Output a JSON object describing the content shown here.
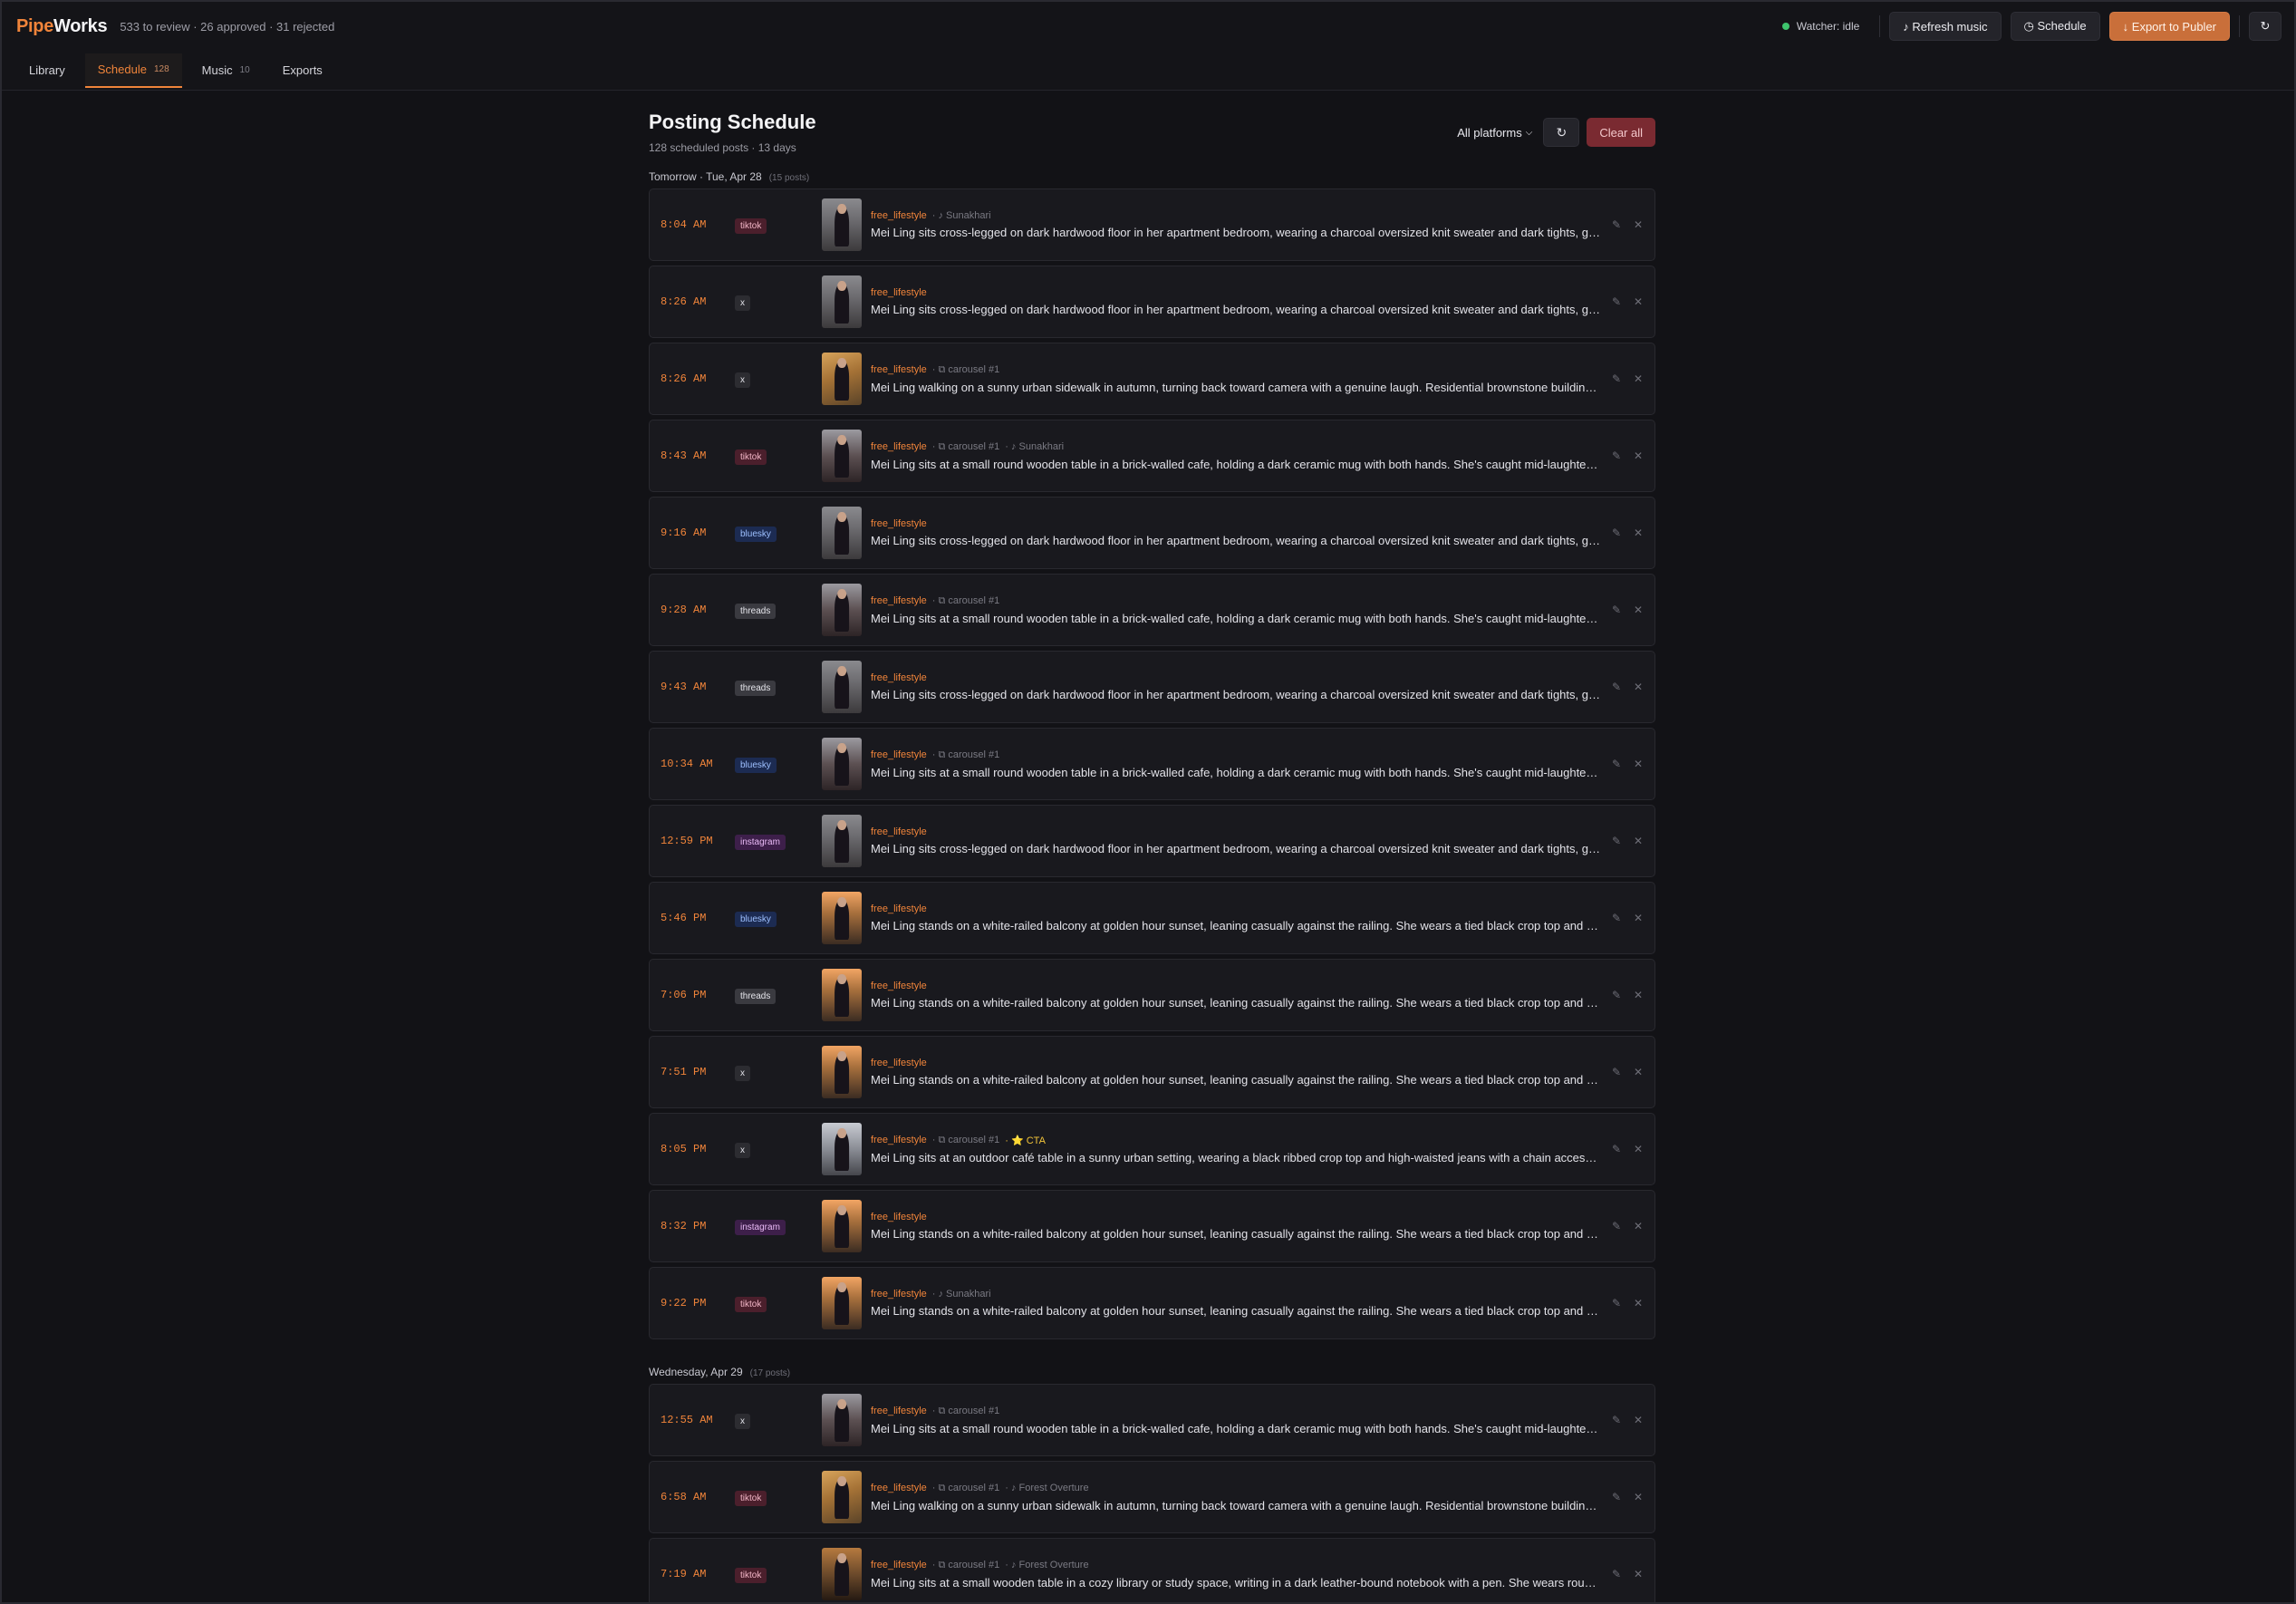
{
  "app": {
    "logo_part1": "Pipe",
    "logo_part2": "Works",
    "stats": "533 to review · 26 approved · 31 rejected",
    "watcher": "Watcher: idle",
    "refresh_music": "♪ Refresh music",
    "schedule": "◷ Schedule",
    "export": "↓ Export to Publer",
    "refresh_icon": "↻"
  },
  "tabs": [
    {
      "label": "Library",
      "count": ""
    },
    {
      "label": "Schedule",
      "count": "128"
    },
    {
      "label": "Music",
      "count": "10"
    },
    {
      "label": "Exports",
      "count": ""
    }
  ],
  "page": {
    "title": "Posting Schedule",
    "subtitle": "128 scheduled posts · 13 days",
    "filter": "All platforms",
    "refresh": "↻",
    "clear": "Clear all"
  },
  "descriptions": {
    "bedroom": "Mei Ling sits cross-legged on dark hardwood floor in her apartment bedroom, wearing a charcoal oversized knit sweater and dark tights, gazi...",
    "street": "Mei Ling walking on a sunny urban sidewalk in autumn, turning back toward camera with a genuine laugh. Residential brownstone buildings a...",
    "cafe": "Mei Ling sits at a small round wooden table in a brick-walled cafe, holding a dark ceramic mug with both hands. She's caught mid-laughter, h...",
    "balcony": "Mei Ling stands on a white-railed balcony at golden hour sunset, leaning casually against the railing. She wears a tied black crop top and burg...",
    "outdoor": "Mei Ling sits at an outdoor café table in a sunny urban setting, wearing a black ribbed crop top and high-waisted jeans with a chain accessory....",
    "library": "Mei Ling sits at a small wooden table in a cozy library or study space, writing in a dark leather-bound notebook with a pen. She wears round w..."
  },
  "days": [
    {
      "label": "Tomorrow · Tue, Apr 28",
      "count": "(15 posts)",
      "posts": [
        {
          "time": "8:04 AM",
          "platform": "tiktok",
          "thumb": "bedroom",
          "category": "free_lifestyle",
          "extras": [
            "· ♪ Sunakhari"
          ],
          "cta": ""
        },
        {
          "time": "8:26 AM",
          "platform": "x",
          "thumb": "bedroom",
          "category": "free_lifestyle",
          "extras": [],
          "cta": ""
        },
        {
          "time": "8:26 AM",
          "platform": "x",
          "thumb": "street",
          "category": "free_lifestyle",
          "extras": [
            "· ⧉ carousel #1"
          ],
          "cta": ""
        },
        {
          "time": "8:43 AM",
          "platform": "tiktok",
          "thumb": "cafe",
          "category": "free_lifestyle",
          "extras": [
            "· ⧉ carousel #1",
            "· ♪ Sunakhari"
          ],
          "cta": ""
        },
        {
          "time": "9:16 AM",
          "platform": "bluesky",
          "thumb": "bedroom",
          "category": "free_lifestyle",
          "extras": [],
          "cta": ""
        },
        {
          "time": "9:28 AM",
          "platform": "threads",
          "thumb": "cafe",
          "category": "free_lifestyle",
          "extras": [
            "· ⧉ carousel #1"
          ],
          "cta": ""
        },
        {
          "time": "9:43 AM",
          "platform": "threads",
          "thumb": "bedroom",
          "category": "free_lifestyle",
          "extras": [],
          "cta": ""
        },
        {
          "time": "10:34 AM",
          "platform": "bluesky",
          "thumb": "cafe",
          "category": "free_lifestyle",
          "extras": [
            "· ⧉ carousel #1"
          ],
          "cta": ""
        },
        {
          "time": "12:59 PM",
          "platform": "instagram",
          "thumb": "bedroom",
          "category": "free_lifestyle",
          "extras": [],
          "cta": ""
        },
        {
          "time": "5:46 PM",
          "platform": "bluesky",
          "thumb": "balcony",
          "category": "free_lifestyle",
          "extras": [],
          "cta": ""
        },
        {
          "time": "7:06 PM",
          "platform": "threads",
          "thumb": "balcony",
          "category": "free_lifestyle",
          "extras": [],
          "cta": ""
        },
        {
          "time": "7:51 PM",
          "platform": "x",
          "thumb": "balcony",
          "category": "free_lifestyle",
          "extras": [],
          "cta": ""
        },
        {
          "time": "8:05 PM",
          "platform": "x",
          "thumb": "outdoor",
          "category": "free_lifestyle",
          "extras": [
            "· ⧉ carousel #1"
          ],
          "cta": "· ⭐ CTA"
        },
        {
          "time": "8:32 PM",
          "platform": "instagram",
          "thumb": "balcony",
          "category": "free_lifestyle",
          "extras": [],
          "cta": ""
        },
        {
          "time": "9:22 PM",
          "platform": "tiktok",
          "thumb": "balcony",
          "category": "free_lifestyle",
          "extras": [
            "· ♪ Sunakhari"
          ],
          "cta": ""
        }
      ]
    },
    {
      "label": "Wednesday, Apr 29",
      "count": "(17 posts)",
      "posts": [
        {
          "time": "12:55 AM",
          "platform": "x",
          "thumb": "cafe",
          "category": "free_lifestyle",
          "extras": [
            "· ⧉ carousel #1"
          ],
          "cta": ""
        },
        {
          "time": "6:58 AM",
          "platform": "tiktok",
          "thumb": "street",
          "category": "free_lifestyle",
          "extras": [
            "· ⧉ carousel #1",
            "· ♪ Forest Overture"
          ],
          "cta": ""
        },
        {
          "time": "7:19 AM",
          "platform": "tiktok",
          "thumb": "library",
          "category": "free_lifestyle",
          "extras": [
            "· ⧉ carousel #1",
            "· ♪ Forest Overture"
          ],
          "cta": ""
        }
      ]
    }
  ],
  "row_actions": {
    "edit": "✎",
    "remove": "✕"
  }
}
